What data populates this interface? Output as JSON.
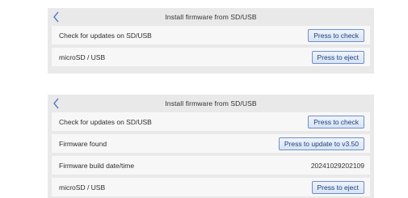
{
  "screens": [
    {
      "title": "Install firmware from SD/USB",
      "rows": [
        {
          "label": "Check for updates on SD/USB",
          "button": "Press to check"
        },
        {
          "label": "microSD / USB",
          "button": "Press to eject"
        }
      ]
    },
    {
      "title": "Install firmware from SD/USB",
      "rows": [
        {
          "label": "Check for updates on SD/USB",
          "button": "Press to check"
        },
        {
          "label": "Firmware found",
          "button": "Press to update to v3.50"
        },
        {
          "label": "Firmware build date/time",
          "value": "20241029202109"
        },
        {
          "label": "microSD / USB",
          "button": "Press to eject"
        }
      ]
    }
  ],
  "colors": {
    "panel_bg": "#e9e9e9",
    "row_bg": "#f7f7f7",
    "accent": "#6f8fc6"
  },
  "icons": {
    "back": "chevron-left-icon"
  }
}
